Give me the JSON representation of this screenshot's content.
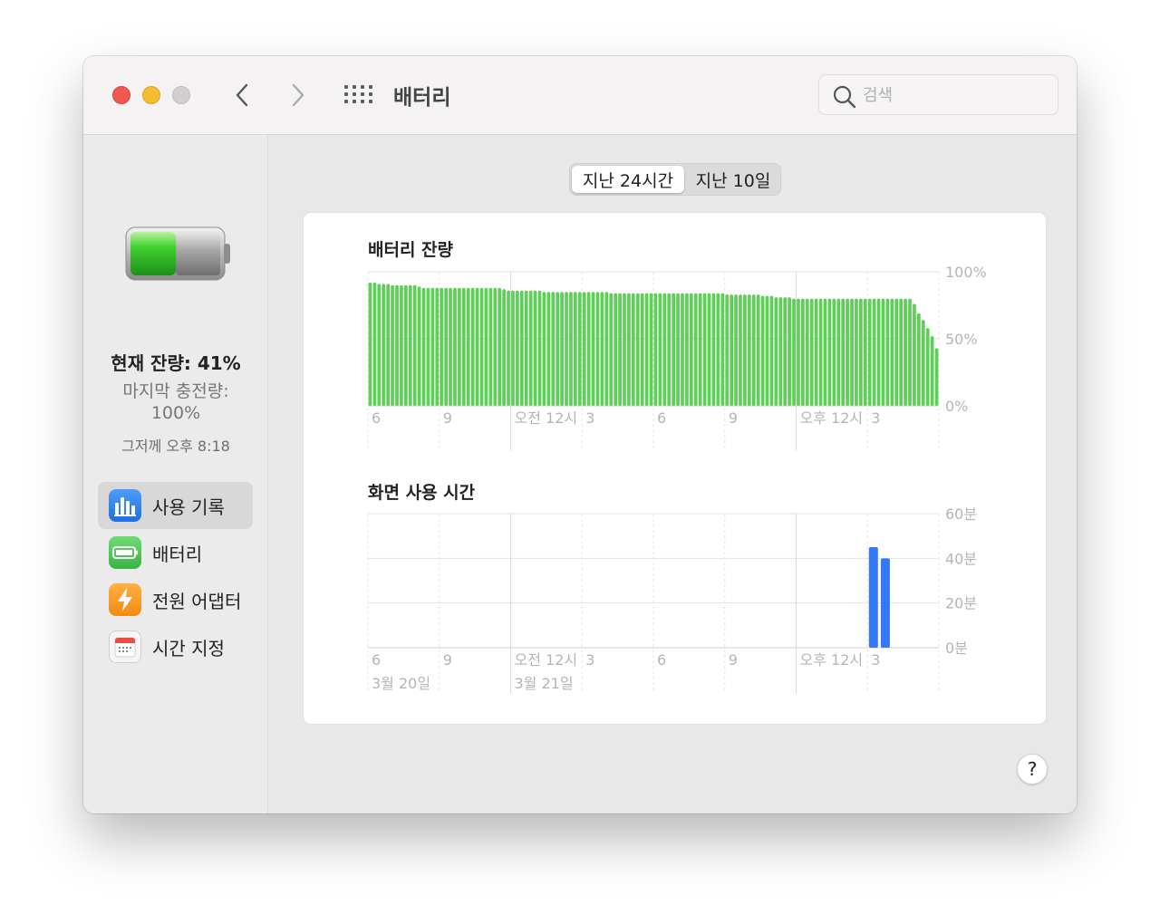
{
  "window": {
    "title": "배터리"
  },
  "search": {
    "placeholder": "검색"
  },
  "sidebar": {
    "current_charge": "현재 잔량: 41%",
    "last_charge_label": "마지막 충전량:",
    "last_charge_value": "100%",
    "last_charge_time": "그저께 오후 8:18",
    "items": [
      {
        "label": "사용 기록",
        "icon": "bar-chart-icon",
        "active": true
      },
      {
        "label": "배터리",
        "icon": "battery-icon",
        "active": false
      },
      {
        "label": "전원 어댑터",
        "icon": "lightning-icon",
        "active": false
      },
      {
        "label": "시간 지정",
        "icon": "calendar-icon",
        "active": false
      }
    ]
  },
  "segmented": {
    "option1": "지난 24시간",
    "option2": "지난 10일",
    "selected": 0
  },
  "colors": {
    "battery_bar": "#5fcf5a",
    "screen_bar": "#3478f6",
    "accent": "#1f6fe0"
  },
  "help": {
    "label": "?"
  },
  "chart_data": [
    {
      "type": "bar",
      "title": "배터리 잔량",
      "y_ticks": [
        "100%",
        "50%",
        "0%"
      ],
      "ylim": [
        0,
        100
      ],
      "x_tick_labels": [
        "6",
        "9",
        "오전 12시",
        "3",
        "6",
        "9",
        "오후 12시",
        "3"
      ],
      "values": [
        92,
        92,
        91,
        91,
        91,
        90,
        90,
        90,
        90,
        90,
        90,
        89,
        88,
        88,
        88,
        88,
        88,
        88,
        88,
        88,
        88,
        88,
        88,
        88,
        88,
        88,
        88,
        88,
        88,
        88,
        87,
        86,
        86,
        86,
        86,
        86,
        86,
        86,
        86,
        85,
        85,
        85,
        85,
        85,
        85,
        85,
        85,
        85,
        85,
        85,
        85,
        85,
        85,
        85,
        84,
        84,
        84,
        84,
        84,
        84,
        84,
        84,
        84,
        84,
        84,
        84,
        84,
        84,
        84,
        84,
        84,
        84,
        84,
        84,
        84,
        84,
        84,
        84,
        84,
        84,
        83,
        83,
        83,
        83,
        83,
        83,
        83,
        83,
        82,
        82,
        82,
        81,
        81,
        81,
        81,
        80,
        80,
        80,
        80,
        80,
        80,
        80,
        80,
        80,
        80,
        80,
        80,
        80,
        80,
        80,
        80,
        80,
        80,
        80,
        80,
        80,
        80,
        80,
        80,
        80,
        80,
        80,
        76,
        69,
        64,
        58,
        52,
        43
      ]
    },
    {
      "type": "bar",
      "title": "화면 사용 시간",
      "y_ticks": [
        "60분",
        "40분",
        "20분",
        "0분"
      ],
      "ylim": [
        0,
        60
      ],
      "x_tick_labels": [
        "6",
        "9",
        "오전 12시",
        "3",
        "6",
        "9",
        "오후 12시",
        "3"
      ],
      "date_labels": [
        "3월 20일",
        "3월 21일"
      ],
      "values": [
        0,
        0,
        0,
        0,
        0,
        0,
        0,
        0,
        0,
        0,
        0,
        0,
        0,
        0,
        0,
        0,
        0,
        0,
        0,
        0,
        0,
        0,
        0,
        0,
        0,
        0,
        0,
        0,
        0,
        0,
        0,
        0,
        0,
        0,
        0,
        0,
        0,
        0,
        0,
        0,
        0,
        0,
        45,
        40,
        0,
        0
      ]
    }
  ]
}
